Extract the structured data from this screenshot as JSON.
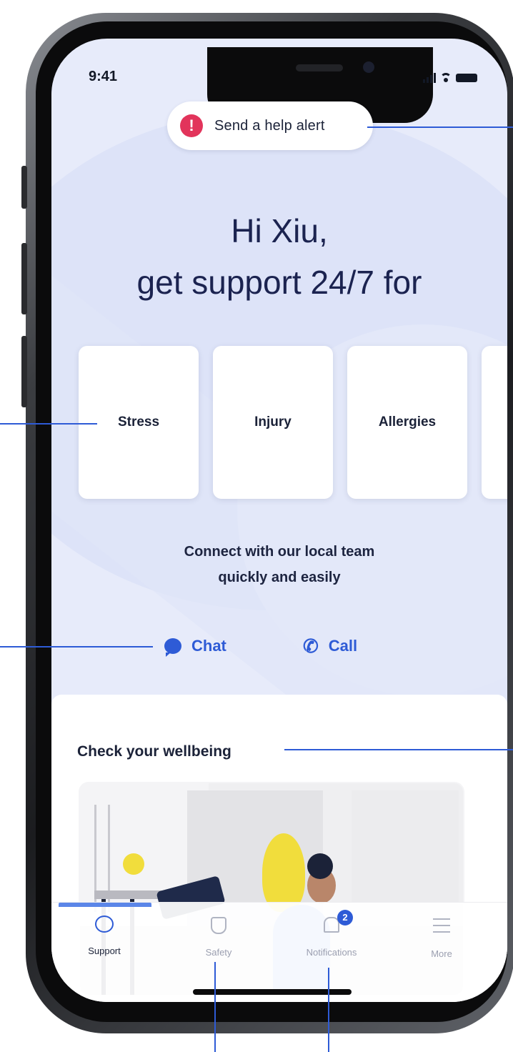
{
  "status_bar": {
    "time": "9:41"
  },
  "help_alert": {
    "icon": "exclamation-icon",
    "glyph": "!",
    "label": "Send a help alert",
    "color": "#e2345b"
  },
  "greeting": {
    "line1": "Hi Xiu,",
    "line2": "get support 24/7 for"
  },
  "categories": [
    "Stress",
    "Injury",
    "Allergies"
  ],
  "connect": {
    "line1": "Connect with our local team",
    "line2": "quickly and easily"
  },
  "actions": {
    "chat_label": "Chat",
    "call_label": "Call",
    "chat_icon": "chat-bubble-icon",
    "call_icon": "phone-icon",
    "call_glyph": "✆"
  },
  "wellbeing": {
    "title": "Check your wellbeing"
  },
  "tabbar": {
    "support_label": "Support",
    "safety_label": "Safety",
    "notifications_label": "Notifications",
    "notifications_badge": "2",
    "more_label": "More"
  },
  "colors": {
    "accent": "#2e5bd6",
    "alert": "#e2345b",
    "heading": "#1b2350",
    "background": "#e7ebfa"
  }
}
